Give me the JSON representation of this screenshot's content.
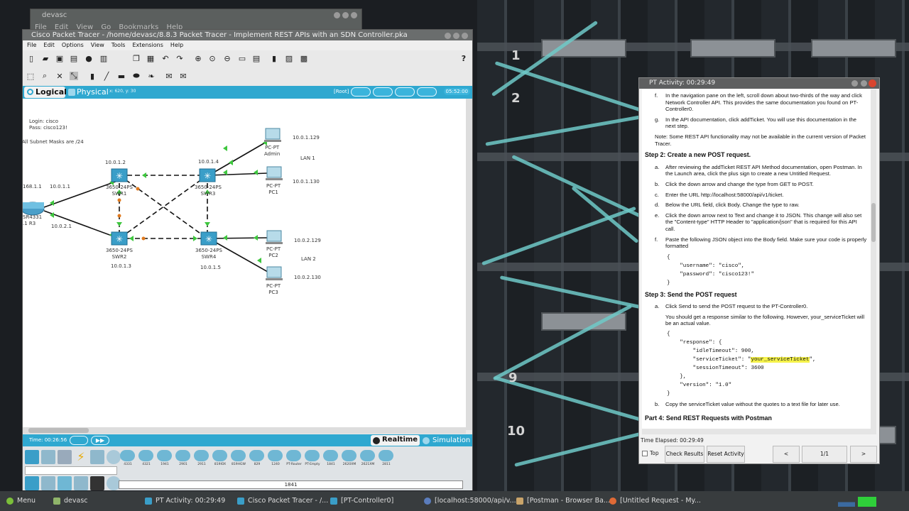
{
  "devasc_window": {
    "title": "devasc",
    "menu": "File  Edit  View  Go  Bookmarks  Help"
  },
  "pt": {
    "title": "Cisco Packet Tracer - /home/devasc/8.8.3 Packet Tracer - Implement REST APIs with an SDN Controller.pka",
    "menu": [
      "File",
      "Edit",
      "Options",
      "View",
      "Tools",
      "Extensions",
      "Help"
    ],
    "help_icon": "?",
    "logical": "Logical",
    "physical": "Physical",
    "coords": "x: 620, y: 30",
    "root": "[Root]",
    "clock": "05:52:00",
    "notes": [
      "Login: cisco",
      "Pass: cisco123!"
    ],
    "subnet_note": "All Subnet Masks are /24",
    "labels": {
      "swr1_ip": "10.0.1.2",
      "swr3_ip": "10.0.1.4",
      "swr1": "3650-24PS\nSWR1",
      "swr3": "3650-24PS\nSWR3",
      "swr2": "3650-24PS\nSWR2",
      "swr4": "3650-24PS\nSWR4",
      "swr2_ip": "10.0.1.3",
      "swr4_ip": "10.0.1.5",
      "router_left": "168.1.1",
      "router_name": "SR4331\n.1 R3",
      "link1": "10.0.1.1",
      "link2": "10.0.2.1",
      "admin": "PC-PT\nAdmin",
      "pc1": "PC-PT\nPC1",
      "pc2": "PC-PT\nPC2",
      "pc3": "PC-PT\nPC3",
      "ip129": "10.0.1.129",
      "ip130": "10.0.1.130",
      "ip2129": "10.0.2.129",
      "ip2130": "10.0.2.130",
      "lan1": "LAN 1",
      "lan2": "LAN 2"
    },
    "time": "Time: 00:26:56",
    "realtime": "Realtime",
    "simulation": "Simulation",
    "devices": [
      "4331",
      "4321",
      "1941",
      "2901",
      "2911",
      "819IOX",
      "819HGW",
      "829",
      "1240",
      "PT-Router",
      "PT-Empty",
      "1841",
      "2620XM",
      "2621XM",
      "2811"
    ],
    "search_value": "1841"
  },
  "activity": {
    "title": "PT Activity: 00:29:49",
    "items_top": [
      {
        "l": "f.",
        "t": "In the navigation pane on the left, scroll down about two-thirds of the way and click Network Controller API. This provides the same documentation you found on PT-Controller0."
      },
      {
        "l": "g.",
        "t": "In the API documentation, click addTicket. You will use this documentation in the next step."
      }
    ],
    "note": "Note: Some REST API functionality may not be available in the current version of Packet Tracer.",
    "step2": "Step 2: Create a new POST request.",
    "items2": [
      {
        "l": "a.",
        "t": "After reviewing the addTicket REST API Method documentation, open Postman. In the Launch area, click the plus sign to create a new Untitled Request."
      },
      {
        "l": "b.",
        "t": "Click the down arrow and change the type from GET to POST."
      },
      {
        "l": "c.",
        "t": "Enter the URL http://localhost:58000/api/v1/ticket."
      },
      {
        "l": "d.",
        "t": "Below the URL field, click Body. Change the type to raw."
      },
      {
        "l": "e.",
        "t": "Click the down arrow next to Text and change it to JSON. This change will also set the \"Content-type\" HTTP Header to \"application/json\" that is required for this API call."
      },
      {
        "l": "f.",
        "t": "Paste the following JSON object into the Body field. Make sure your code is properly formatted"
      }
    ],
    "code1": "{\n    \"username\": \"cisco\",\n    \"password\": \"cisco123!\"\n}",
    "step3": "Step 3: Send the POST request",
    "item3a": {
      "l": "a.",
      "t": "Click Send to send the POST request to the PT-Controller0."
    },
    "item3a_sub": "You should get a response similar to the following. However, your_serviceTicket will be an actual value.",
    "code2_pre": "{\n    \"response\": {\n        \"idleTimeout\": 900,\n        \"serviceTicket\": \"",
    "code2_hl": "your_serviceTicket",
    "code2_post": "\",\n        \"sessionTimeout\": 3600\n    },\n    \"version\": \"1.0\"\n}",
    "item3b": {
      "l": "b.",
      "t": "Copy the serviceTicket value without the quotes to a text file for later use."
    },
    "cut_heading": "Part 4: Send REST Requests with Postman",
    "elapsed": "Time Elapsed: 00:29:49",
    "top": "Top",
    "check": "Check Results",
    "reset": "Reset Activity",
    "prev": "<",
    "page": "1/1",
    "next": ">"
  },
  "bg": {
    "slot_numbers": [
      "1",
      "2",
      "9",
      "10"
    ]
  },
  "taskbar": {
    "menu": "Menu",
    "items": [
      "devasc",
      "PT Activity: 00:29:49",
      "Cisco Packet Tracer - /...",
      "[PT-Controller0]",
      "[localhost:58000/api/v...",
      "[Postman - Browser Ba...",
      "[Untitled Request - My..."
    ]
  }
}
